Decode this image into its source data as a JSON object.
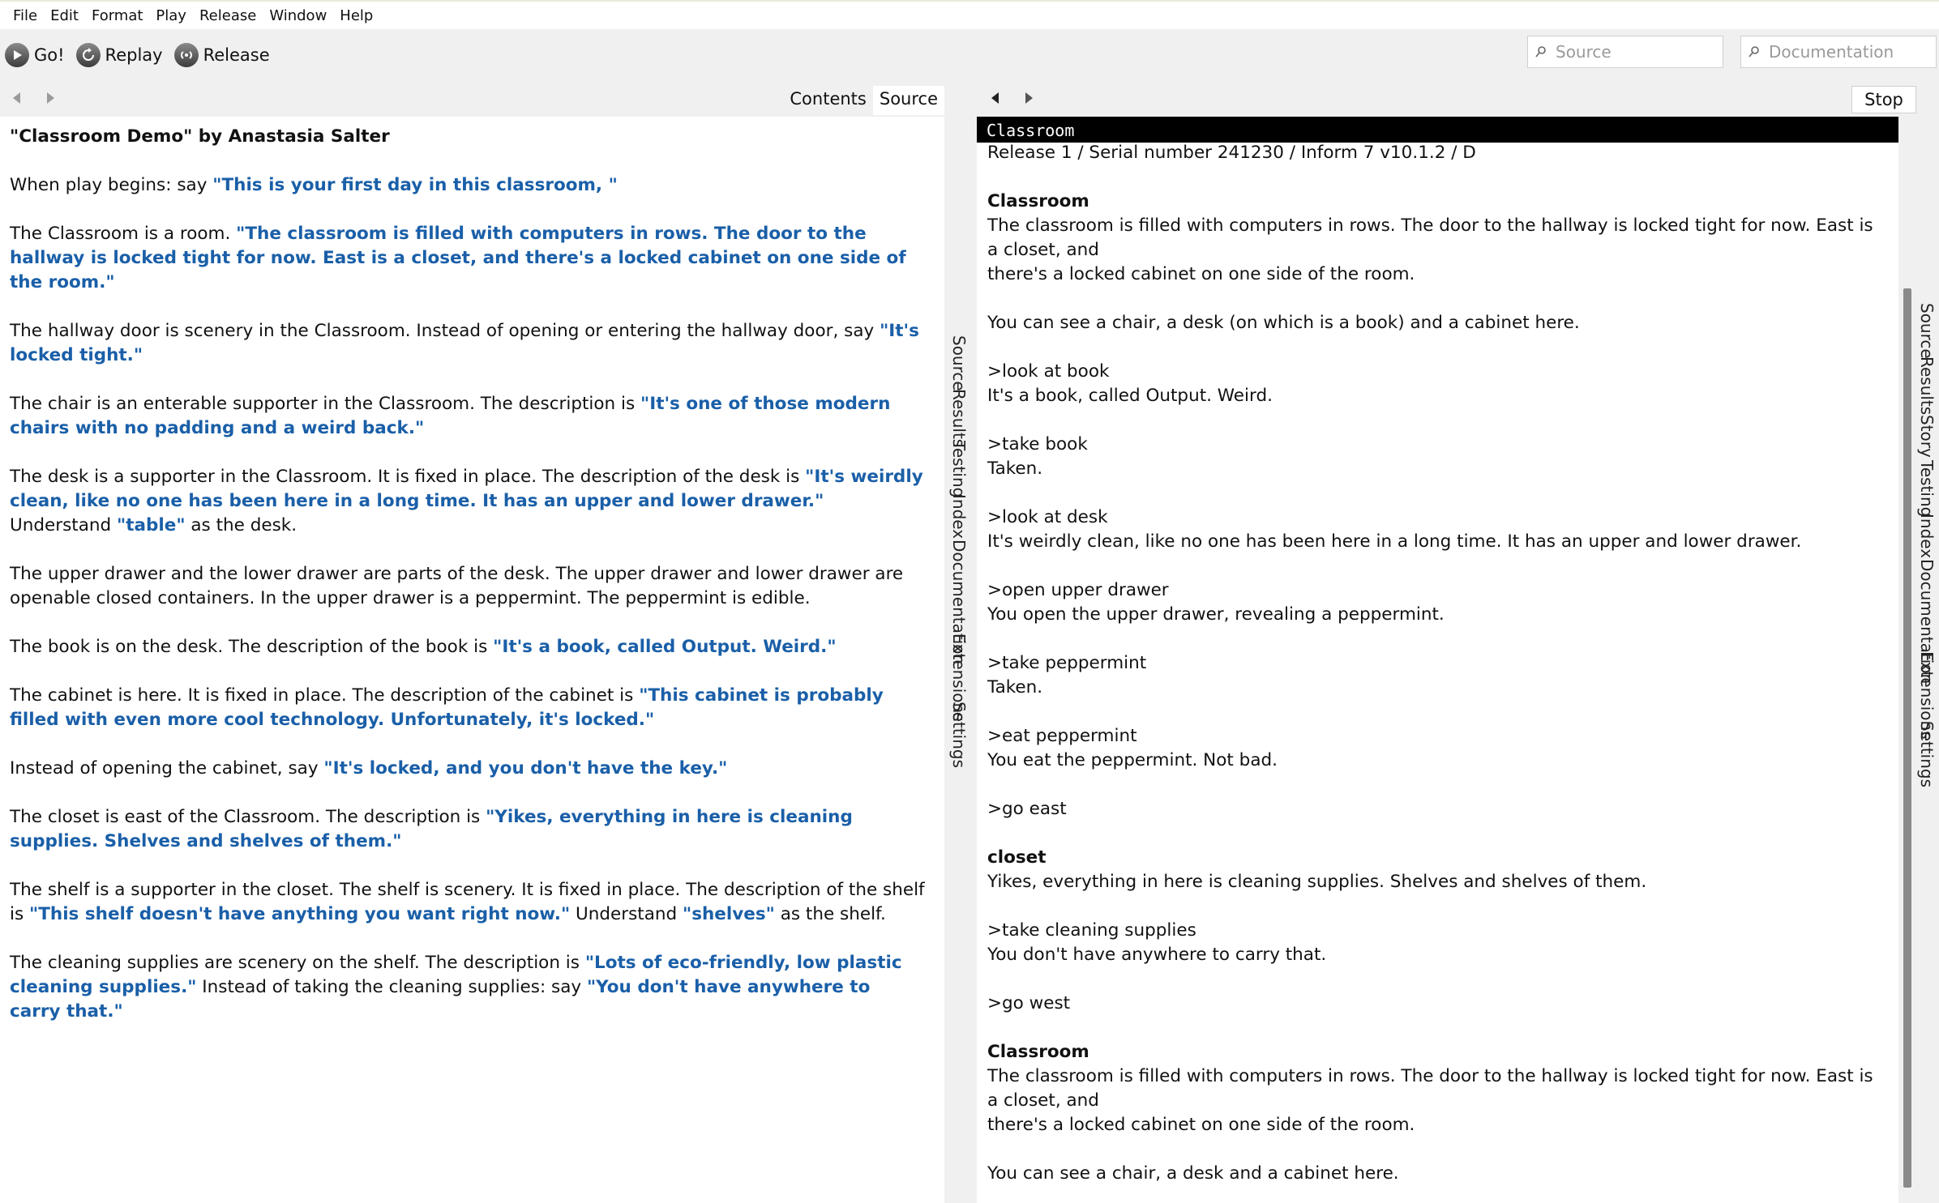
{
  "menu": [
    "File",
    "Edit",
    "Format",
    "Play",
    "Release",
    "Window",
    "Help"
  ],
  "toolbar": {
    "go_label": "Go!",
    "replay_label": "Replay",
    "release_label": "Release",
    "source_search_placeholder": "Source",
    "docs_search_placeholder": "Documentation"
  },
  "left_tabs": {
    "contents": "Contents",
    "source": "Source"
  },
  "source": {
    "title": "\"Classroom Demo\" by Anastasia Salter",
    "paragraphs": [
      {
        "segments": [
          {
            "t": "When play begins: say "
          },
          {
            "q": "\"This is your first day in this classroom, \""
          }
        ]
      },
      {
        "segments": [
          {
            "t": "The Classroom is a room. "
          },
          {
            "q": "\"The classroom is filled with computers in rows. The door to the hallway is locked tight for now. East is a closet, and there's a locked cabinet on one side of the room.\""
          }
        ]
      },
      {
        "segments": [
          {
            "t": "The hallway door is scenery in the Classroom. Instead of opening or entering the hallway door, say "
          },
          {
            "q": "\"It's locked tight.\""
          }
        ]
      },
      {
        "segments": [
          {
            "t": "The chair is an enterable supporter in the Classroom. The description is "
          },
          {
            "q": "\"It's one of those modern chairs with no padding and a weird back.\""
          }
        ]
      },
      {
        "segments": [
          {
            "t": "The desk is a supporter in the Classroom. It is fixed in place. The description of the desk is "
          },
          {
            "q": "\"It's weirdly clean, like no one has been here in a long time. It has an upper and lower drawer.\""
          },
          {
            "t": " Understand "
          },
          {
            "q": "\"table\""
          },
          {
            "t": " as the desk."
          }
        ]
      },
      {
        "segments": [
          {
            "t": "The upper drawer and the lower drawer are parts of the desk. The upper drawer and lower drawer are openable closed containers. In the upper drawer is a peppermint. The peppermint is edible."
          }
        ]
      },
      {
        "segments": [
          {
            "t": "The book is on the desk. The description of the book is "
          },
          {
            "q": "\"It's a book, called Output. Weird.\""
          }
        ]
      },
      {
        "segments": [
          {
            "t": "The cabinet is here. It is fixed in place. The description of the cabinet is "
          },
          {
            "q": "\"This cabinet is probably filled with even more cool technology. Unfortunately, it's locked.\""
          }
        ]
      },
      {
        "segments": [
          {
            "t": "Instead of opening the cabinet, say "
          },
          {
            "q": "\"It's locked, and you don't have the key.\""
          }
        ]
      },
      {
        "segments": [
          {
            "t": "The closet is east of the Classroom. The description is "
          },
          {
            "q": "\"Yikes, everything in here is cleaning supplies. Shelves and shelves of them.\""
          }
        ]
      },
      {
        "segments": [
          {
            "t": "The shelf is a supporter in the closet. The shelf is scenery. It is fixed in place. The description of the shelf is "
          },
          {
            "q": "\"This shelf doesn't have anything you want right now.\""
          },
          {
            "t": " Understand "
          },
          {
            "q": "\"shelves\""
          },
          {
            "t": " as the shelf."
          }
        ]
      },
      {
        "segments": [
          {
            "t": "The cleaning supplies are scenery on the shelf. The description is "
          },
          {
            "q": "\"Lots of eco-friendly, low plastic cleaning supplies.\""
          },
          {
            "t": " Instead of taking the cleaning supplies: say "
          },
          {
            "q": "\"You don't have anywhere to carry that.\""
          }
        ]
      }
    ]
  },
  "middle_tabs": [
    "Source",
    "Results",
    "Testing",
    "Index",
    "Documentation",
    "Extensions",
    "Settings"
  ],
  "right_tabs": [
    "Source",
    "Results",
    "Story",
    "Testing",
    "Index",
    "Documentation",
    "Extensions",
    "Settings"
  ],
  "story": {
    "stop_label": "Stop",
    "status_line": "Classroom",
    "lines": [
      {
        "text": "Release 1 / Serial number 241230 / Inform 7 v10.1.2 / D"
      },
      {
        "text": ""
      },
      {
        "text": "Classroom",
        "bold": true
      },
      {
        "text": "The classroom is filled with computers in rows. The door to the hallway is locked tight for now. East is a closet, and"
      },
      {
        "text": "there's a locked cabinet on one side of the room."
      },
      {
        "text": ""
      },
      {
        "text": "You can see a chair, a desk (on which is a book) and a cabinet here."
      },
      {
        "text": ""
      },
      {
        "text": ">look at book"
      },
      {
        "text": "It's a book, called Output. Weird."
      },
      {
        "text": ""
      },
      {
        "text": ">take book"
      },
      {
        "text": "Taken."
      },
      {
        "text": ""
      },
      {
        "text": ">look at desk"
      },
      {
        "text": "It's weirdly clean, like no one has been here in a long time. It has an upper and lower drawer."
      },
      {
        "text": ""
      },
      {
        "text": ">open upper drawer"
      },
      {
        "text": "You open the upper drawer, revealing a peppermint."
      },
      {
        "text": ""
      },
      {
        "text": ">take peppermint"
      },
      {
        "text": "Taken."
      },
      {
        "text": ""
      },
      {
        "text": ">eat peppermint"
      },
      {
        "text": "You eat the peppermint. Not bad."
      },
      {
        "text": ""
      },
      {
        "text": ">go east"
      },
      {
        "text": ""
      },
      {
        "text": "closet",
        "bold": true
      },
      {
        "text": "Yikes, everything in here is cleaning supplies. Shelves and shelves of them."
      },
      {
        "text": ""
      },
      {
        "text": ">take cleaning supplies"
      },
      {
        "text": "You don't have anywhere to carry that."
      },
      {
        "text": ""
      },
      {
        "text": ">go west"
      },
      {
        "text": ""
      },
      {
        "text": "Classroom",
        "bold": true
      },
      {
        "text": "The classroom is filled with computers in rows. The door to the hallway is locked tight for now. East is a closet, and"
      },
      {
        "text": "there's a locked cabinet on one side of the room."
      },
      {
        "text": ""
      },
      {
        "text": "You can see a chair, a desk and a cabinet here."
      },
      {
        "text": ""
      }
    ],
    "prompt": ">"
  }
}
